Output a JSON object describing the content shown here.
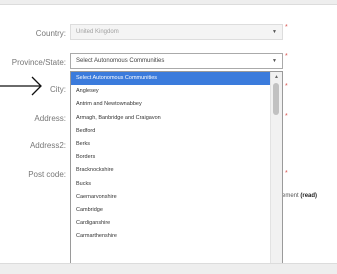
{
  "form": {
    "country": {
      "label": "Country:",
      "value": "United Kingdom",
      "required_mark": "*"
    },
    "province": {
      "label": "Province/State:",
      "value": "Select Autonomous Communities",
      "required_mark": "*"
    },
    "city": {
      "label": "City:"
    },
    "address": {
      "label": "Address:"
    },
    "address2": {
      "label": "Address2:"
    },
    "post_code": {
      "label": "Post code:"
    }
  },
  "side_text": {
    "prefix": "ement",
    "bold": "(read)"
  },
  "dropdown": {
    "options": [
      "Select Autonomous Communities",
      "Anglesey",
      "Antrim and Newtownabbey",
      "Armagh, Banbridge and Craigavon",
      "Bedford",
      "Berks",
      "Borders",
      "Bracknockshire",
      "Bucks",
      "Caernarvonshire",
      "Cambridge",
      "Cardiganshire",
      "Carmarthenshire"
    ],
    "selected_index": 0,
    "colors": {
      "selected_background": "#3b7bdc",
      "selected_text": "#ffffff"
    }
  },
  "colors": {
    "required": "#d9534f",
    "label": "#777777"
  }
}
